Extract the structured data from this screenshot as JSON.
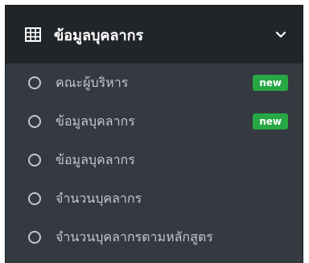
{
  "menu": {
    "title": "ข้อมูลบุคลากร",
    "icon": "table-icon",
    "toggle_icon": "chevron-down-icon",
    "items": [
      {
        "label": "คณะผู้บริหาร",
        "badge": "new",
        "icon": "circle-icon"
      },
      {
        "label": "ข้อมูลบุคลากร",
        "badge": "new",
        "icon": "circle-icon"
      },
      {
        "label": "ข้อมูลบุคลากร",
        "badge": "",
        "icon": "circle-icon"
      },
      {
        "label": "จำนวนบุคลากร",
        "badge": "",
        "icon": "circle-icon"
      },
      {
        "label": "จำนวนบุคลากรตามหลักสูตร",
        "badge": "",
        "icon": "circle-icon"
      }
    ]
  },
  "colors": {
    "header_bg": "#212529",
    "body_bg": "#343a40",
    "text_header": "#ffffff",
    "text_item": "#c2c7d0",
    "badge_bg": "#28a745"
  }
}
